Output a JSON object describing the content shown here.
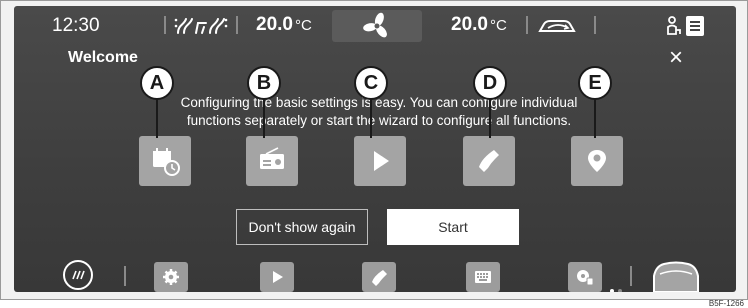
{
  "status_bar": {
    "time": "12:30",
    "left_temp": "20.0",
    "right_temp": "20.0",
    "unit": "°C",
    "icons": [
      "seat-heating-icon",
      "fan-icon",
      "recirculation-icon",
      "person-icon",
      "menu-icon"
    ]
  },
  "welcome": {
    "title": "Welcome",
    "close_label": "×",
    "description": "Configuring the basic settings is easy. You can configure individual functions separately or start the wizard to configure all functions."
  },
  "callouts": [
    "A",
    "B",
    "C",
    "D",
    "E"
  ],
  "tiles": [
    "calendar-clock-icon",
    "radio-icon",
    "play-icon",
    "phone-icon",
    "location-pin-icon"
  ],
  "buttons": {
    "dont_show": "Don't show again",
    "start": "Start"
  },
  "dock": {
    "icons": [
      "menu-round-icon",
      "settings-icon",
      "play-icon",
      "phone-icon",
      "keyboard-icon",
      "media-icon",
      "car-icon"
    ]
  },
  "watermark": "B5F-1266",
  "colors": {
    "screen_bg": "#434343",
    "tile_bg": "#a4a4a4",
    "text": "#ffffff"
  }
}
